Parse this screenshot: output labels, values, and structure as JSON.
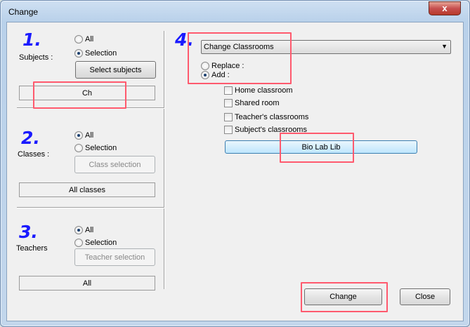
{
  "window": {
    "title": "Change",
    "close_glyph": "x"
  },
  "steps": {
    "n1": "1.",
    "n2": "2.",
    "n3": "3.",
    "n4": "4."
  },
  "subjects": {
    "label": "Subjects :",
    "opt_all": "All",
    "opt_selection": "Selection",
    "selected": "selection",
    "button": "Select subjects",
    "value": "Ch"
  },
  "classes": {
    "label": "Classes :",
    "opt_all": "All",
    "opt_selection": "Selection",
    "selected": "all",
    "button": "Class selection",
    "value": "All classes"
  },
  "teachers": {
    "label": "Teachers",
    "opt_all": "All",
    "opt_selection": "Selection",
    "selected": "all",
    "button": "Teacher selection",
    "value": "All"
  },
  "change_panel": {
    "dropdown_value": "Change Classrooms",
    "replace_label": "Replace :",
    "add_label": "Add :",
    "mode_selected": "add",
    "checks": [
      {
        "label": "Home classroom",
        "checked": false
      },
      {
        "label": "Shared room",
        "checked": false
      },
      {
        "label": "Teacher's classrooms",
        "checked": false
      },
      {
        "label": "Subject's classrooms",
        "checked": false
      }
    ],
    "rooms_button": "Bio Lab Lib"
  },
  "actions": {
    "change": "Change",
    "close": "Close"
  },
  "colors": {
    "accent_blue": "#1a1aff",
    "highlight": "#ff5a6e"
  }
}
